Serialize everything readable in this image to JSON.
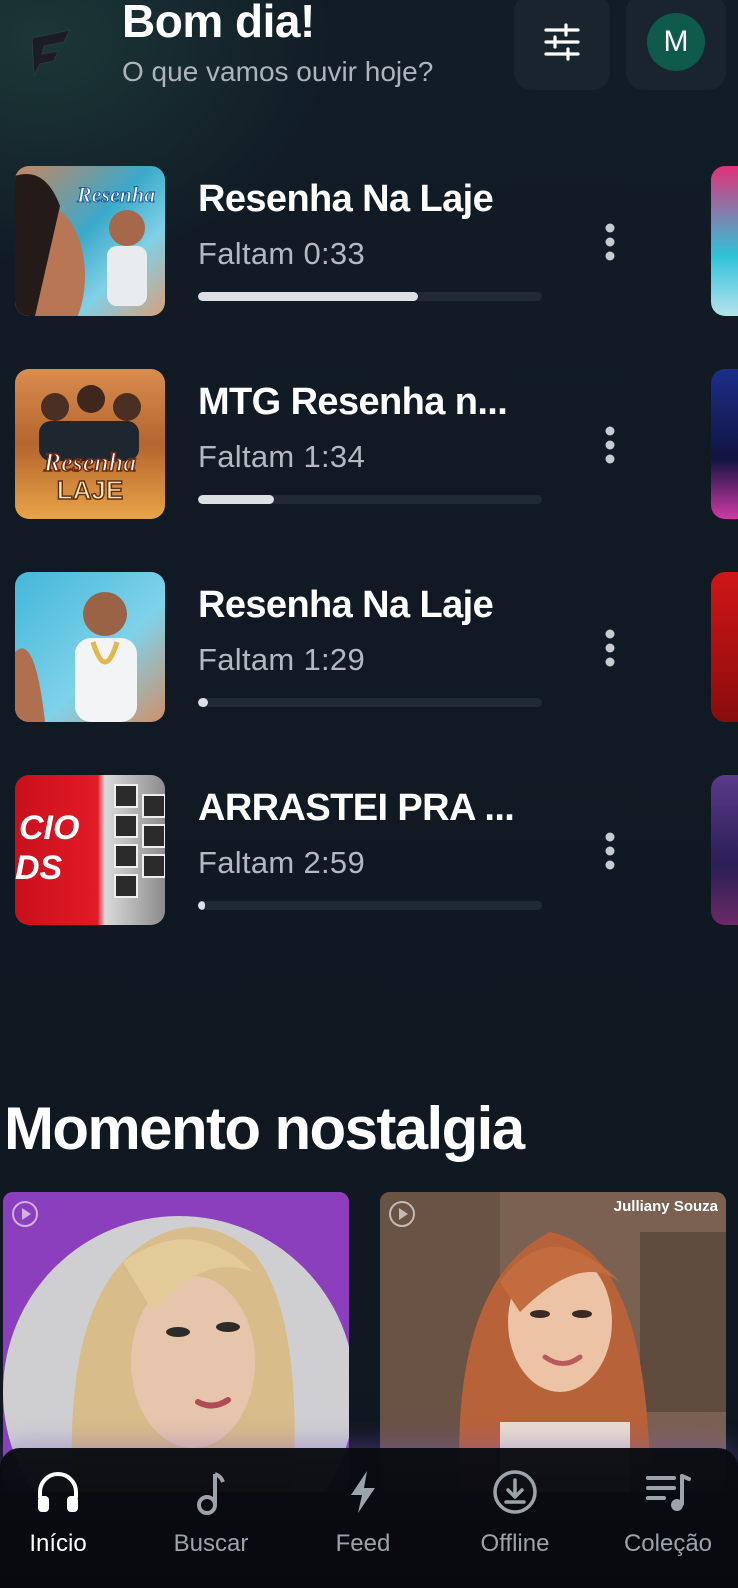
{
  "header": {
    "greeting": "Bom dia!",
    "subtitle": "O que vamos ouvir hoje?",
    "avatar_initial": "M",
    "logo_icon": "app-logo-icon",
    "settings_icon": "sliders-icon"
  },
  "resume_tracks": [
    {
      "title": "Resenha Na Laje",
      "remaining": "Faltam 0:33",
      "progress": 0.64
    },
    {
      "title": "MTG Resenha n...",
      "remaining": "Faltam 1:34",
      "progress": 0.22
    },
    {
      "title": "Resenha Na Laje",
      "remaining": "Faltam 1:29",
      "progress": 0.03
    },
    {
      "title": "ARRASTEI PRA ...",
      "remaining": "Faltam 2:59",
      "progress": 0.02
    }
  ],
  "section": {
    "title": "Momento nostalgia",
    "cards": [
      {
        "caption": ""
      },
      {
        "caption": "Julliany Souza"
      }
    ]
  },
  "nav": {
    "items": [
      {
        "label": "Início",
        "icon": "headphones-icon",
        "active": true
      },
      {
        "label": "Buscar",
        "icon": "music-note-icon",
        "active": false
      },
      {
        "label": "Feed",
        "icon": "lightning-icon",
        "active": false
      },
      {
        "label": "Offline",
        "icon": "download-icon",
        "active": false
      },
      {
        "label": "Coleção",
        "icon": "playlist-icon",
        "active": false
      }
    ]
  },
  "colors": {
    "background": "#101821",
    "accent_avatar": "#0f5a4a",
    "progress_fill": "#dcdfe3",
    "progress_track": "#1f2a36"
  }
}
